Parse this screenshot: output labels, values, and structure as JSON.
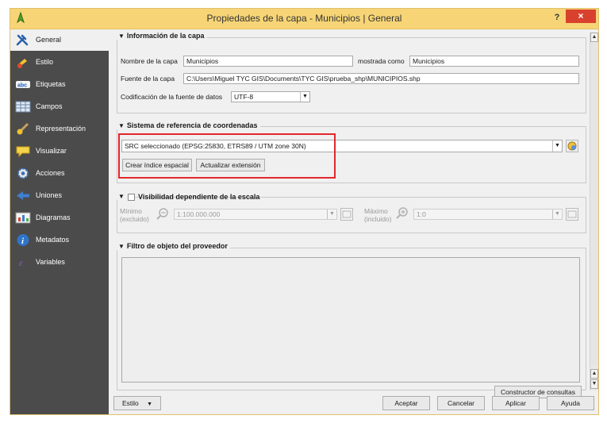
{
  "window": {
    "title": "Propiedades de la capa - Municipios | General",
    "help": "?",
    "close": "×"
  },
  "sidebar": {
    "items": [
      {
        "label": "General",
        "icon": "wrench-icon"
      },
      {
        "label": "Estilo",
        "icon": "style-brush-icon"
      },
      {
        "label": "Etiquetas",
        "icon": "labels-abc-icon"
      },
      {
        "label": "Campos",
        "icon": "table-fields-icon"
      },
      {
        "label": "Representación",
        "icon": "render-brush-icon"
      },
      {
        "label": "Visualizar",
        "icon": "speech-bubble-icon"
      },
      {
        "label": "Acciones",
        "icon": "gear-action-icon"
      },
      {
        "label": "Uniones",
        "icon": "join-arrow-icon"
      },
      {
        "label": "Diagramas",
        "icon": "diagram-icon"
      },
      {
        "label": "Metadatos",
        "icon": "info-icon"
      },
      {
        "label": "Variables",
        "icon": "variables-icon"
      }
    ]
  },
  "layer_info": {
    "title": "Información de la capa",
    "name_label": "Nombre de la capa",
    "name_value": "Municipios",
    "shown_as_label": "mostrada como",
    "shown_as_value": "Municipios",
    "source_label": "Fuente de la capa",
    "source_value": "C:\\Users\\Miguel TYC GIS\\Documents\\TYC GIS\\prueba_shp\\MUNICIPIOS.shp",
    "encoding_label": "Codificación de la fuente de datos",
    "encoding_value": "UTF-8"
  },
  "crs": {
    "title": "Sistema de referencia de coordenadas",
    "selected": "SRC seleccionado (EPSG:25830, ETRS89 / UTM zone 30N)",
    "create_index": "Crear índice espacial",
    "update_extent": "Actualizar extensión"
  },
  "scale": {
    "title": "Visibilidad dependiente de la escala",
    "min_label_1": "Mínimo",
    "min_label_2": "(excluido)",
    "min_value": "1:100.000.000",
    "max_label_1": "Máximo",
    "max_label_2": "(incluido)",
    "max_value": "1:0"
  },
  "filter": {
    "title": "Filtro de objeto del proveedor",
    "query_builder": "Constructor de consultas"
  },
  "footer": {
    "style": "Estilo",
    "accept": "Aceptar",
    "cancel": "Cancelar",
    "apply": "Aplicar",
    "help": "Ayuda"
  },
  "colors": {
    "titlebar": "#f7d576",
    "close": "#d9412f",
    "sidebar": "#4b4b4b",
    "highlight": "#e3272b"
  }
}
